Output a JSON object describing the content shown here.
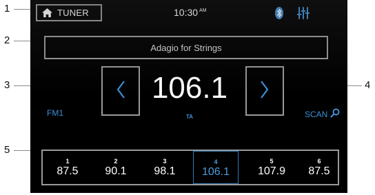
{
  "callouts": [
    "1",
    "2",
    "3",
    "4",
    "5"
  ],
  "header": {
    "source_label": "TUNER",
    "clock": "10:30",
    "clock_suffix": "AM"
  },
  "station": {
    "text": "Adagio for Strings",
    "frequency": "106.1",
    "ta_label": "TA",
    "band": "FM1",
    "scan_label": "SCAN"
  },
  "presets": [
    {
      "num": "1",
      "freq": "87.5"
    },
    {
      "num": "2",
      "freq": "90.1"
    },
    {
      "num": "3",
      "freq": "98.1"
    },
    {
      "num": "4",
      "freq": "106.1",
      "selected": true
    },
    {
      "num": "5",
      "freq": "107.9"
    },
    {
      "num": "6",
      "freq": "87.5"
    }
  ],
  "colors": {
    "accent": "#3d8fd6",
    "screen_background": "#000000",
    "outline": "#9a9a9a"
  },
  "icons": [
    "home-icon",
    "bluetooth-icon",
    "equalizer-icon",
    "chevron-left-icon",
    "chevron-right-icon",
    "search-icon"
  ]
}
